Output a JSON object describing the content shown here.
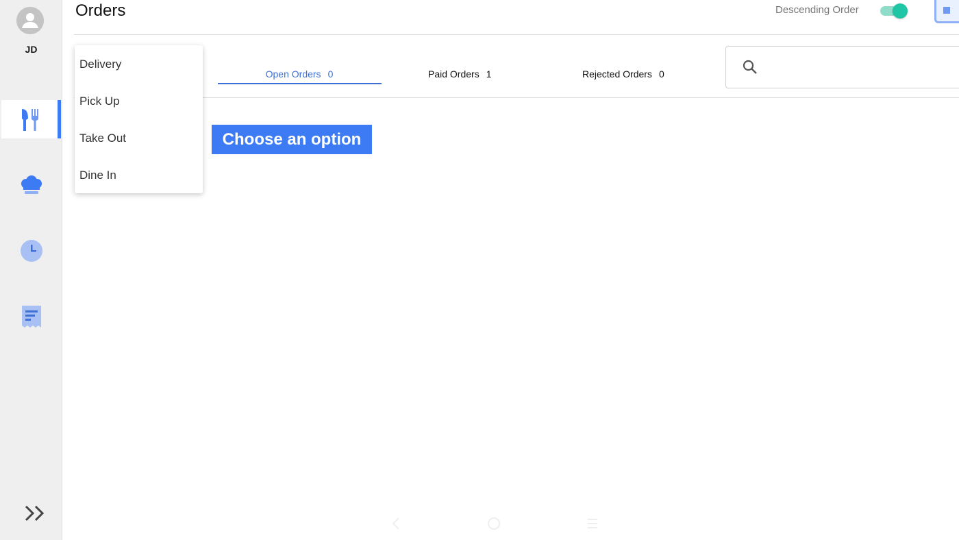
{
  "sidebar": {
    "initials": "JD",
    "nav": [
      {
        "name": "menu",
        "icon": "fork-knife-icon",
        "active": true
      },
      {
        "name": "kitchen",
        "icon": "chef-hat-icon"
      },
      {
        "name": "history",
        "icon": "clock-icon"
      },
      {
        "name": "receipts",
        "icon": "receipt-icon"
      }
    ],
    "expand_icon": "double-chevron-right-icon"
  },
  "header": {
    "title": "Orders",
    "sort_label": "Descending Order",
    "sort_toggle_on": true
  },
  "tabs": [
    {
      "label": "Open Orders",
      "count": "0",
      "active": true
    },
    {
      "label": "Paid Orders",
      "count": "1",
      "active": false
    },
    {
      "label": "Rejected Orders",
      "count": "0",
      "active": false
    }
  ],
  "search": {
    "placeholder": "",
    "icon": "search-icon"
  },
  "dropdown": {
    "items": [
      "Delivery",
      "Pick Up",
      "Take Out",
      "Dine In"
    ]
  },
  "banner": "Choose an option",
  "colors": {
    "accent": "#3d7bf5",
    "tab_active": "#3d6fd6",
    "toggle": "#1fc6a5",
    "sidebar_bg": "#efefef"
  }
}
